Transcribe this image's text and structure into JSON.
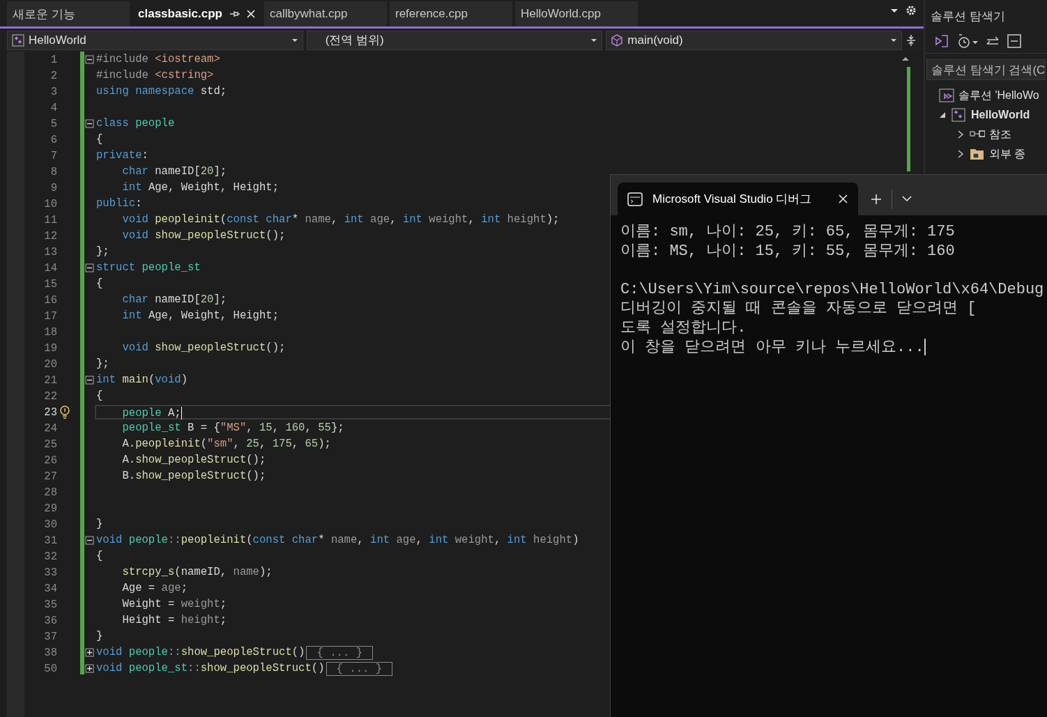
{
  "editor_tabs": [
    {
      "label": "새로운 기능",
      "selected": false,
      "pinned": false,
      "closable": false
    },
    {
      "label": "classbasic.cpp",
      "selected": true,
      "pinned": true,
      "closable": true
    },
    {
      "label": "callbywhat.cpp",
      "selected": false,
      "pinned": false,
      "closable": false
    },
    {
      "label": "reference.cpp",
      "selected": false,
      "pinned": false,
      "closable": false
    },
    {
      "label": "HelloWorld.cpp",
      "selected": false,
      "pinned": false,
      "closable": false
    }
  ],
  "navigation": {
    "project": "HelloWorld",
    "scope": "(전역 범위)",
    "member": "main(void)"
  },
  "code": [
    {
      "number": "1",
      "expanded": true,
      "tokens": [
        {
          "text": "#include ",
          "kind": "pre"
        },
        {
          "text": "<iostream>",
          "kind": "str"
        }
      ]
    },
    {
      "number": "2",
      "tokens": [
        {
          "text": "#include ",
          "kind": "pre"
        },
        {
          "text": "<cstring>",
          "kind": "str"
        }
      ]
    },
    {
      "number": "3",
      "tokens": [
        {
          "text": "using ",
          "kind": "kw"
        },
        {
          "text": "namespace ",
          "kind": "kw"
        },
        {
          "text": "std;",
          "kind": "plain"
        }
      ]
    },
    {
      "number": "4"
    },
    {
      "number": "5",
      "expanded": true,
      "tokens": [
        {
          "text": "class ",
          "kind": "kw"
        },
        {
          "text": "people",
          "kind": "type"
        }
      ]
    },
    {
      "number": "6",
      "tokens": [
        {
          "text": "{",
          "kind": "plain"
        }
      ]
    },
    {
      "number": "7",
      "tokens": [
        {
          "text": "private",
          "kind": "kw"
        },
        {
          "text": ":",
          "kind": "plain"
        }
      ]
    },
    {
      "number": "8",
      "tokens": [
        {
          "text": "    char ",
          "kind": "kw"
        },
        {
          "text": "nameID[",
          "kind": "plain"
        },
        {
          "text": "20",
          "kind": "num"
        },
        {
          "text": "];",
          "kind": "plain"
        }
      ]
    },
    {
      "number": "9",
      "tokens": [
        {
          "text": "    int ",
          "kind": "kw"
        },
        {
          "text": "Age, Weight, Height;",
          "kind": "plain"
        }
      ]
    },
    {
      "number": "10",
      "tokens": [
        {
          "text": "public",
          "kind": "kw"
        },
        {
          "text": ":",
          "kind": "plain"
        }
      ]
    },
    {
      "number": "11",
      "tokens": [
        {
          "text": "    void ",
          "kind": "kw"
        },
        {
          "text": "peopleinit",
          "kind": "fn"
        },
        {
          "text": "(",
          "kind": "plain"
        },
        {
          "text": "const char",
          "kind": "kw"
        },
        {
          "text": "* ",
          "kind": "plain"
        },
        {
          "text": "name",
          "kind": "param"
        },
        {
          "text": ", ",
          "kind": "plain"
        },
        {
          "text": "int ",
          "kind": "kw"
        },
        {
          "text": "age",
          "kind": "param"
        },
        {
          "text": ", ",
          "kind": "plain"
        },
        {
          "text": "int ",
          "kind": "kw"
        },
        {
          "text": "weight",
          "kind": "param"
        },
        {
          "text": ", ",
          "kind": "plain"
        },
        {
          "text": "int ",
          "kind": "kw"
        },
        {
          "text": "height",
          "kind": "param"
        },
        {
          "text": ");",
          "kind": "plain"
        }
      ]
    },
    {
      "number": "12",
      "tokens": [
        {
          "text": "    void ",
          "kind": "kw"
        },
        {
          "text": "show_peopleStruct",
          "kind": "fn"
        },
        {
          "text": "();",
          "kind": "plain"
        }
      ]
    },
    {
      "number": "13",
      "tokens": [
        {
          "text": "};",
          "kind": "plain"
        }
      ]
    },
    {
      "number": "14",
      "expanded": true,
      "tokens": [
        {
          "text": "struct ",
          "kind": "kw"
        },
        {
          "text": "people_st",
          "kind": "type"
        }
      ]
    },
    {
      "number": "15",
      "tokens": [
        {
          "text": "{",
          "kind": "plain"
        }
      ]
    },
    {
      "number": "16",
      "tokens": [
        {
          "text": "    char ",
          "kind": "kw"
        },
        {
          "text": "nameID[",
          "kind": "plain"
        },
        {
          "text": "20",
          "kind": "num"
        },
        {
          "text": "];",
          "kind": "plain"
        }
      ]
    },
    {
      "number": "17",
      "tokens": [
        {
          "text": "    int ",
          "kind": "kw"
        },
        {
          "text": "Age, Weight, Height;",
          "kind": "plain"
        }
      ]
    },
    {
      "number": "18"
    },
    {
      "number": "19",
      "tokens": [
        {
          "text": "    void ",
          "kind": "kw"
        },
        {
          "text": "show_peopleStruct",
          "kind": "fn"
        },
        {
          "text": "();",
          "kind": "plain"
        }
      ]
    },
    {
      "number": "20",
      "tokens": [
        {
          "text": "};",
          "kind": "plain"
        }
      ]
    },
    {
      "number": "21",
      "expanded": true,
      "tokens": [
        {
          "text": "int ",
          "kind": "kw"
        },
        {
          "text": "main",
          "kind": "fn"
        },
        {
          "text": "(",
          "kind": "plain"
        },
        {
          "text": "void",
          "kind": "kw"
        },
        {
          "text": ")",
          "kind": "plain"
        }
      ]
    },
    {
      "number": "22",
      "tokens": [
        {
          "text": "{",
          "kind": "plain"
        }
      ]
    },
    {
      "number": "23",
      "current": true,
      "tokens": [
        {
          "text": "    people ",
          "kind": "type"
        },
        {
          "text": "A;",
          "kind": "plain"
        }
      ]
    },
    {
      "number": "24",
      "tokens": [
        {
          "text": "    people_st ",
          "kind": "type"
        },
        {
          "text": "B = {",
          "kind": "plain"
        },
        {
          "text": "\"MS\"",
          "kind": "str"
        },
        {
          "text": ", ",
          "kind": "plain"
        },
        {
          "text": "15",
          "kind": "num"
        },
        {
          "text": ", ",
          "kind": "plain"
        },
        {
          "text": "160",
          "kind": "num"
        },
        {
          "text": ", ",
          "kind": "plain"
        },
        {
          "text": "55",
          "kind": "num"
        },
        {
          "text": "};",
          "kind": "plain"
        }
      ]
    },
    {
      "number": "25",
      "tokens": [
        {
          "text": "    A.",
          "kind": "plain"
        },
        {
          "text": "peopleinit",
          "kind": "fn"
        },
        {
          "text": "(",
          "kind": "plain"
        },
        {
          "text": "\"sm\"",
          "kind": "str"
        },
        {
          "text": ", ",
          "kind": "plain"
        },
        {
          "text": "25",
          "kind": "num"
        },
        {
          "text": ", ",
          "kind": "plain"
        },
        {
          "text": "175",
          "kind": "num"
        },
        {
          "text": ", ",
          "kind": "plain"
        },
        {
          "text": "65",
          "kind": "num"
        },
        {
          "text": ");",
          "kind": "plain"
        }
      ]
    },
    {
      "number": "26",
      "tokens": [
        {
          "text": "    A.",
          "kind": "plain"
        },
        {
          "text": "show_peopleStruct",
          "kind": "fn"
        },
        {
          "text": "();",
          "kind": "plain"
        }
      ]
    },
    {
      "number": "27",
      "tokens": [
        {
          "text": "    B.",
          "kind": "plain"
        },
        {
          "text": "show_peopleStruct",
          "kind": "fn"
        },
        {
          "text": "();",
          "kind": "plain"
        }
      ]
    },
    {
      "number": "28"
    },
    {
      "number": "29"
    },
    {
      "number": "30",
      "tokens": [
        {
          "text": "}",
          "kind": "plain"
        }
      ]
    },
    {
      "number": "31",
      "expanded": true,
      "tokens": [
        {
          "text": "void ",
          "kind": "kw"
        },
        {
          "text": "people",
          "kind": "type"
        },
        {
          "text": "::",
          "kind": "param"
        },
        {
          "text": "peopleinit",
          "kind": "fn"
        },
        {
          "text": "(",
          "kind": "plain"
        },
        {
          "text": "const char",
          "kind": "kw"
        },
        {
          "text": "* ",
          "kind": "plain"
        },
        {
          "text": "name",
          "kind": "param"
        },
        {
          "text": ", ",
          "kind": "plain"
        },
        {
          "text": "int ",
          "kind": "kw"
        },
        {
          "text": "age",
          "kind": "param"
        },
        {
          "text": ", ",
          "kind": "plain"
        },
        {
          "text": "int ",
          "kind": "kw"
        },
        {
          "text": "weight",
          "kind": "param"
        },
        {
          "text": ", ",
          "kind": "plain"
        },
        {
          "text": "int ",
          "kind": "kw"
        },
        {
          "text": "height",
          "kind": "param"
        },
        {
          "text": ")",
          "kind": "plain"
        }
      ]
    },
    {
      "number": "32",
      "tokens": [
        {
          "text": "{",
          "kind": "plain"
        }
      ]
    },
    {
      "number": "33",
      "tokens": [
        {
          "text": "    strcpy_s",
          "kind": "fn"
        },
        {
          "text": "(nameID, ",
          "kind": "plain"
        },
        {
          "text": "name",
          "kind": "param"
        },
        {
          "text": ");",
          "kind": "plain"
        }
      ]
    },
    {
      "number": "34",
      "tokens": [
        {
          "text": "    Age = ",
          "kind": "plain"
        },
        {
          "text": "age",
          "kind": "param"
        },
        {
          "text": ";",
          "kind": "plain"
        }
      ]
    },
    {
      "number": "35",
      "tokens": [
        {
          "text": "    Weight = ",
          "kind": "plain"
        },
        {
          "text": "weight",
          "kind": "param"
        },
        {
          "text": ";",
          "kind": "plain"
        }
      ]
    },
    {
      "number": "36",
      "tokens": [
        {
          "text": "    Height = ",
          "kind": "plain"
        },
        {
          "text": "height",
          "kind": "param"
        },
        {
          "text": ";",
          "kind": "plain"
        }
      ]
    },
    {
      "number": "37",
      "tokens": [
        {
          "text": "}",
          "kind": "plain"
        }
      ]
    },
    {
      "number": "38",
      "expanded": false,
      "tokens": [
        {
          "text": "void ",
          "kind": "kw"
        },
        {
          "text": "people",
          "kind": "type"
        },
        {
          "text": "::",
          "kind": "param"
        },
        {
          "text": "show_peopleStruct",
          "kind": "fn"
        },
        {
          "text": "()",
          "kind": "plain"
        }
      ],
      "folded": "{ ... }"
    },
    {
      "number": "50",
      "expanded": false,
      "tokens": [
        {
          "text": "void ",
          "kind": "kw"
        },
        {
          "text": "people_st",
          "kind": "type"
        },
        {
          "text": "::",
          "kind": "param"
        },
        {
          "text": "show_peopleStruct",
          "kind": "fn"
        },
        {
          "text": "()",
          "kind": "plain"
        }
      ],
      "folded": "{ ... }"
    }
  ],
  "solution_explorer": {
    "title": "솔루션 탐색기",
    "search": {
      "placeholder": "솔루션 탐색기 검색(C"
    },
    "tree": [
      {
        "label": "솔루션 'HelloWo",
        "kind": "solution",
        "children": [
          {
            "label": "HelloWorld",
            "kind": "project",
            "expanded": true,
            "children": [
              {
                "label": "참조",
                "kind": "references",
                "expanded": false
              },
              {
                "label": "외부 종",
                "kind": "folder",
                "expanded": false
              }
            ]
          }
        ]
      }
    ]
  },
  "console": {
    "tab_title": "Microsoft Visual Studio 디버그",
    "output": [
      "이름: sm, 나이: 25, 키: 65, 몸무게: 175",
      "이름: MS, 나이: 15, 키: 55, 몸무게: 160"
    ],
    "messages": [
      "C:\\Users\\Yim\\source\\repos\\HelloWorld\\x64\\Debug",
      "디버깅이 중지될 때 콘솔을 자동으로 닫으려면 [",
      "도록 설정합니다.",
      "이 창을 닫으려면 아무 키나 누르세요..."
    ]
  }
}
